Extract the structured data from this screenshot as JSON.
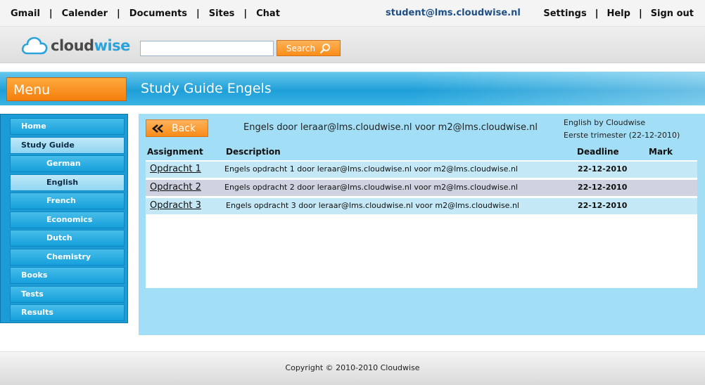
{
  "topnav": {
    "left": [
      "Gmail",
      "Calender",
      "Documents",
      "Sites",
      "Chat"
    ],
    "user_email": "student@lms.cloudwise.nl",
    "right": [
      "Settings",
      "Help",
      "Sign out"
    ]
  },
  "brand": {
    "logo_part1": "cloud",
    "logo_part2": "wise",
    "search_placeholder": "",
    "search_label": "Search"
  },
  "band": {
    "menu_label": "Menu",
    "page_title": "Study Guide Engels"
  },
  "sidebar": {
    "items": [
      {
        "label": "Home"
      },
      {
        "label": "Study Guide"
      },
      {
        "label": "German"
      },
      {
        "label": "English"
      },
      {
        "label": "French"
      },
      {
        "label": "Economics"
      },
      {
        "label": "Dutch"
      },
      {
        "label": "Chemistry"
      },
      {
        "label": "Books"
      },
      {
        "label": "Tests"
      },
      {
        "label": "Results"
      }
    ]
  },
  "content": {
    "back_label": "Back",
    "info_line": "Engels door leraar@lms.cloudwise.nl voor m2@lms.cloudwise.nl",
    "course_line1": "English by Cloudwise",
    "course_line2": "Eerste trimester (22-12-2010)",
    "columns": {
      "assignment": "Assignment",
      "description": "Description",
      "deadline": "Deadline",
      "mark": "Mark"
    },
    "rows": [
      {
        "assignment": "Opdracht 1",
        "description": "Engels opdracht 1 door leraar@lms.cloudwise.nl voor m2@lms.cloudwise.nl",
        "deadline": "22-12-2010",
        "mark": ""
      },
      {
        "assignment": "Opdracht 2",
        "description": "Engels opdracht 2 door leraar@lms.cloudwise.nl voor m2@lms.cloudwise.nl",
        "deadline": "22-12-2010",
        "mark": ""
      },
      {
        "assignment": "Opdracht 3",
        "description": "Engels opdracht 3 door leraar@lms.cloudwise.nl voor m2@lms.cloudwise.nl",
        "deadline": "22-12-2010",
        "mark": ""
      }
    ]
  },
  "footer": {
    "copyright": "Copyright © 2010-2010 Cloudwise"
  },
  "colors": {
    "accent_orange": "#f98d18",
    "accent_blue": "#1e9fd8",
    "panel_blue": "#a2def5"
  }
}
